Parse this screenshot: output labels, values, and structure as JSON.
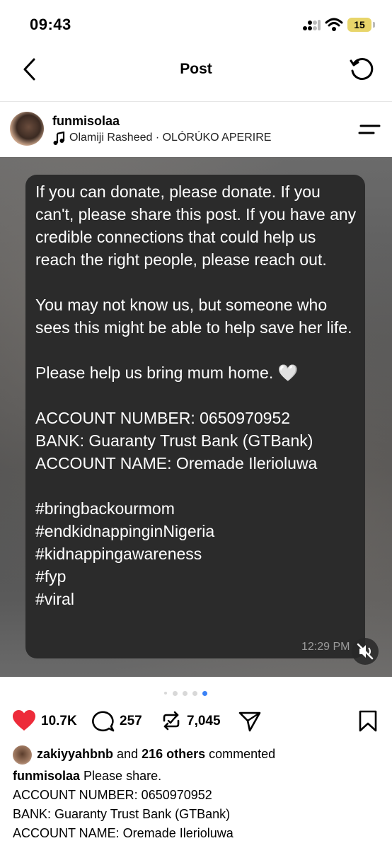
{
  "status_bar": {
    "time": "09:43",
    "battery": "15"
  },
  "nav": {
    "title": "Post"
  },
  "post": {
    "username": "funmisolaa",
    "audio": "Olamiji Rasheed · OLÓRÚKO APERIRE",
    "media_text": "If you can donate, please donate. If you can't, please share this post. If you have any credible connections that could help us reach the right people, please reach out.\n\nYou may not know us, but someone who sees this might be able to help save her life.\n\nPlease help us bring mum home. 🤍\n\nACCOUNT NUMBER: 0650970952\nBANK: Guaranty Trust Bank (GTBank)\nACCOUNT NAME: Oremade Ilerioluwa\n\n#bringbackourmom\n#endkidnappinginNigeria\n#kidnappingawareness\n#fyp\n#viral",
    "message_time": "12:29 PM",
    "carousel": {
      "count": 5,
      "active_index": 4
    }
  },
  "actions": {
    "likes": "10.7K",
    "comments": "257",
    "reposts": "7,045"
  },
  "comments_summary": {
    "user": "zakiyyahbnb",
    "and": " and ",
    "others": "216 others",
    "suffix": " commented"
  },
  "caption": {
    "username": "funmisolaa",
    "text": " Please share.\nACCOUNT NUMBER: 0650970952\nBANK: Guaranty Trust Bank (GTBank)\nACCOUNT NAME: Oremade Ilerioluwa"
  }
}
